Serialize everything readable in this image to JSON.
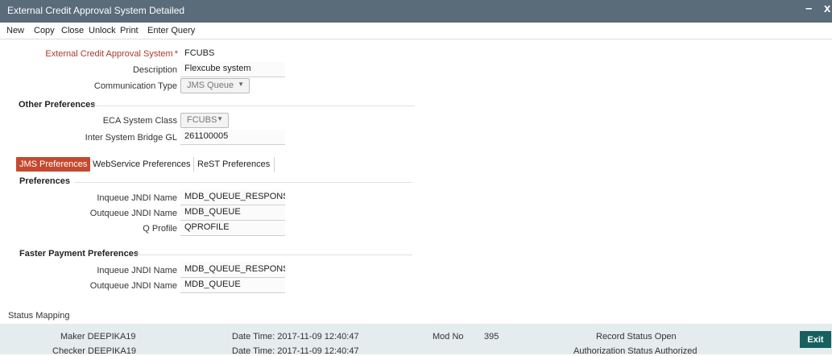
{
  "window": {
    "title": "External Credit Approval System Detailed",
    "minimize_label": "–",
    "close_label": "x"
  },
  "toolbar": {
    "items": [
      "New",
      "Copy",
      "Close",
      "Unlock",
      "Print",
      "Enter Query"
    ]
  },
  "main": {
    "eca_system": {
      "label": "External Credit Approval System",
      "required_marker": "*",
      "value": "FCUBS"
    },
    "description": {
      "label": "Description",
      "value": "Flexcube system"
    },
    "communication_type": {
      "label": "Communication Type",
      "value": "JMS Queue"
    }
  },
  "other_preferences": {
    "title": "Other Preferences",
    "eca_system_class": {
      "label": "ECA System Class",
      "value": "FCUBS"
    },
    "inter_system_bridge_gl": {
      "label": "Inter System Bridge GL",
      "value": "261100005"
    }
  },
  "tabs": [
    {
      "label": "JMS Preferences",
      "active": true
    },
    {
      "label": "WebService Preferences",
      "active": false
    },
    {
      "label": "ReST Preferences",
      "active": false
    }
  ],
  "preferences": {
    "title": "Preferences",
    "inqueue_jndi_name": {
      "label": "Inqueue JNDI Name",
      "value": "MDB_QUEUE_RESPONS"
    },
    "outqueue_jndi_name": {
      "label": "Outqueue JNDI Name",
      "value": "MDB_QUEUE"
    },
    "q_profile": {
      "label": "Q Profile",
      "value": "QPROFILE"
    }
  },
  "faster_payment": {
    "title": "Faster Payment Preferences",
    "inqueue_jndi_name": {
      "label": "Inqueue JNDI Name",
      "value": "MDB_QUEUE_RESPONS"
    },
    "outqueue_jndi_name": {
      "label": "Outqueue JNDI Name",
      "value": "MDB_QUEUE"
    }
  },
  "status_mapping": {
    "label": "Status Mapping"
  },
  "footer": {
    "maker": "Maker DEEPIKA19",
    "checker": "Checker DEEPIKA19",
    "maker_datetime": "Date Time: 2017-11-09 12:40:47",
    "checker_datetime": "Date Time: 2017-11-09 12:40:47",
    "mod_no_label": "Mod No",
    "mod_no_value": "395",
    "record_status": "Record Status Open",
    "authorization_status": "Authorization Status Authorized",
    "exit_label": "Exit"
  },
  "colors": {
    "titlebar": "#5a6b7a",
    "active_tab": "#c44a2f",
    "required_label": "#a43a33",
    "footer_bg": "#e4ecee",
    "exit_button": "#16605f"
  }
}
